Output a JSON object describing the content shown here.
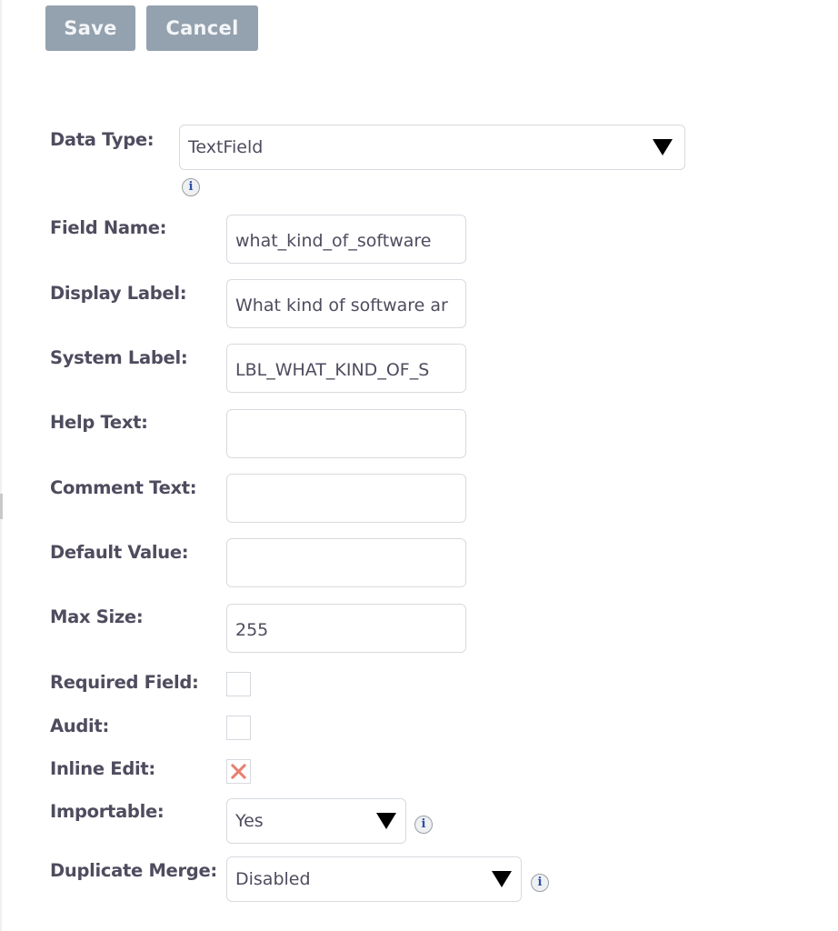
{
  "toolbar": {
    "save_label": "Save",
    "cancel_label": "Cancel"
  },
  "form": {
    "data_type": {
      "label": "Data Type:",
      "value": "TextField",
      "info_icon": "info-icon"
    },
    "field_name": {
      "label": "Field Name:",
      "value": "what_kind_of_software"
    },
    "display_label": {
      "label": "Display Label:",
      "value": "What kind of software ar"
    },
    "system_label": {
      "label": "System Label:",
      "value": "LBL_WHAT_KIND_OF_S"
    },
    "help_text": {
      "label": "Help Text:",
      "value": ""
    },
    "comment_text": {
      "label": "Comment Text:",
      "value": ""
    },
    "default_value": {
      "label": "Default Value:",
      "value": ""
    },
    "max_size": {
      "label": "Max Size:",
      "value": "255"
    },
    "required_field": {
      "label": "Required Field:",
      "checked": false
    },
    "audit": {
      "label": "Audit:",
      "checked": false
    },
    "inline_edit": {
      "label": "Inline Edit:",
      "checked": true,
      "check_icon": "x-mark-icon"
    },
    "importable": {
      "label": "Importable:",
      "value": "Yes",
      "info_icon": "info-icon"
    },
    "duplicate_merge": {
      "label": "Duplicate Merge:",
      "value": "Disabled",
      "info_icon": "info-icon"
    }
  },
  "colors": {
    "button_bg": "#94a1ae",
    "label_text": "#4e4c5e",
    "input_border": "#d7dadf",
    "check_mark": "#e8806f"
  }
}
